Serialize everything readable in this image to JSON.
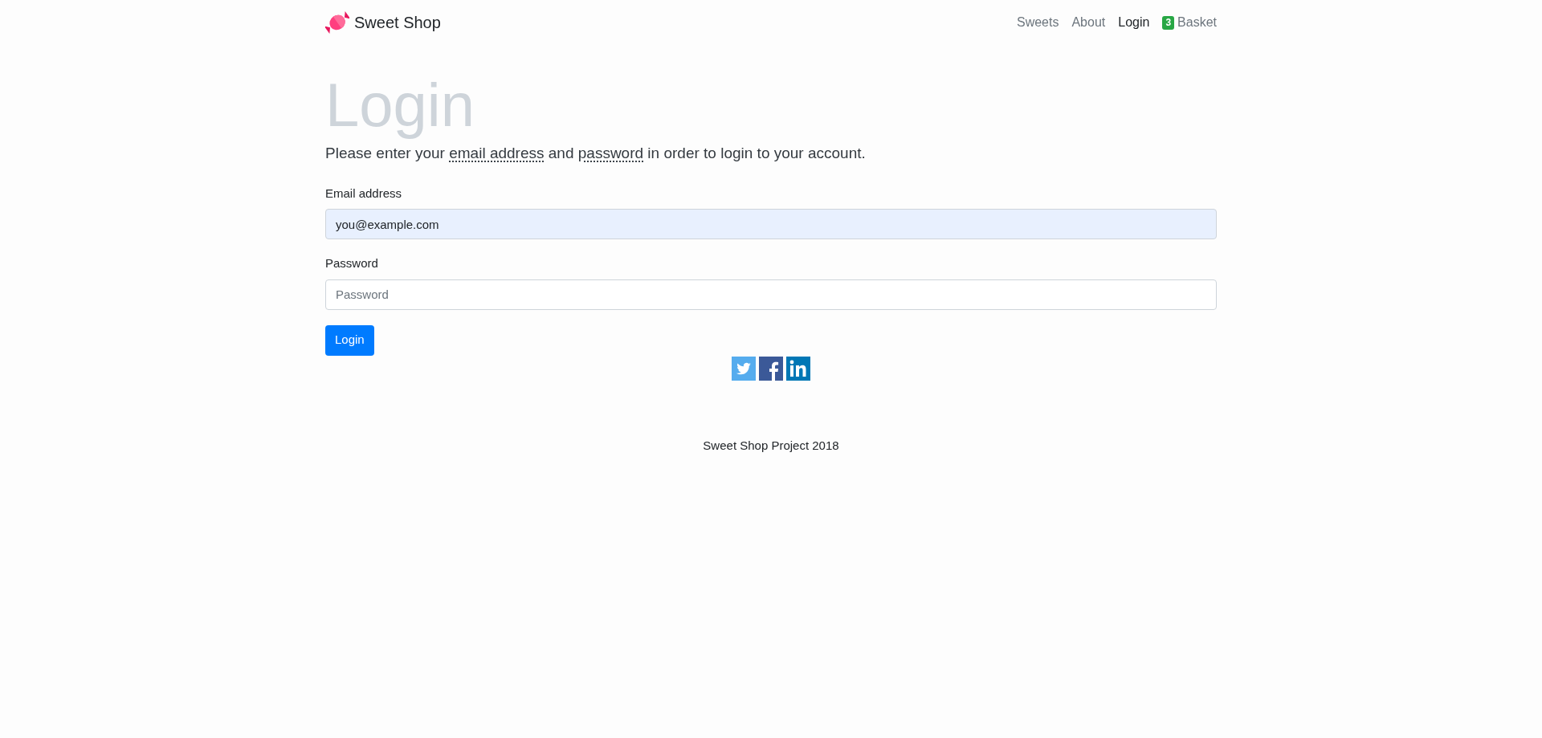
{
  "navbar": {
    "brand": "Sweet Shop",
    "links": [
      {
        "label": "Sweets",
        "selected": false
      },
      {
        "label": "About",
        "selected": false
      },
      {
        "label": "Login",
        "selected": true
      },
      {
        "label": "Basket",
        "selected": false,
        "badge": "3"
      }
    ]
  },
  "heading": "Login",
  "intro": [
    {
      "text": "Please enter your ",
      "abbr": false
    },
    {
      "text": "email address",
      "abbr": true
    },
    {
      "text": " and ",
      "abbr": false
    },
    {
      "text": "password",
      "abbr": true
    },
    {
      "text": " in order to login to your account.",
      "abbr": false
    }
  ],
  "form": {
    "fields": [
      {
        "label": "Email address",
        "value": "you@example.com",
        "autofilled": true
      },
      {
        "label": "Password",
        "placeholder": "Password",
        "autofilled": false
      }
    ],
    "submit": "Login"
  },
  "social": [
    {
      "kind": "twitter"
    },
    {
      "kind": "facebook"
    },
    {
      "kind": "linkedin"
    }
  ],
  "footer": "Sweet Shop Project 2018"
}
